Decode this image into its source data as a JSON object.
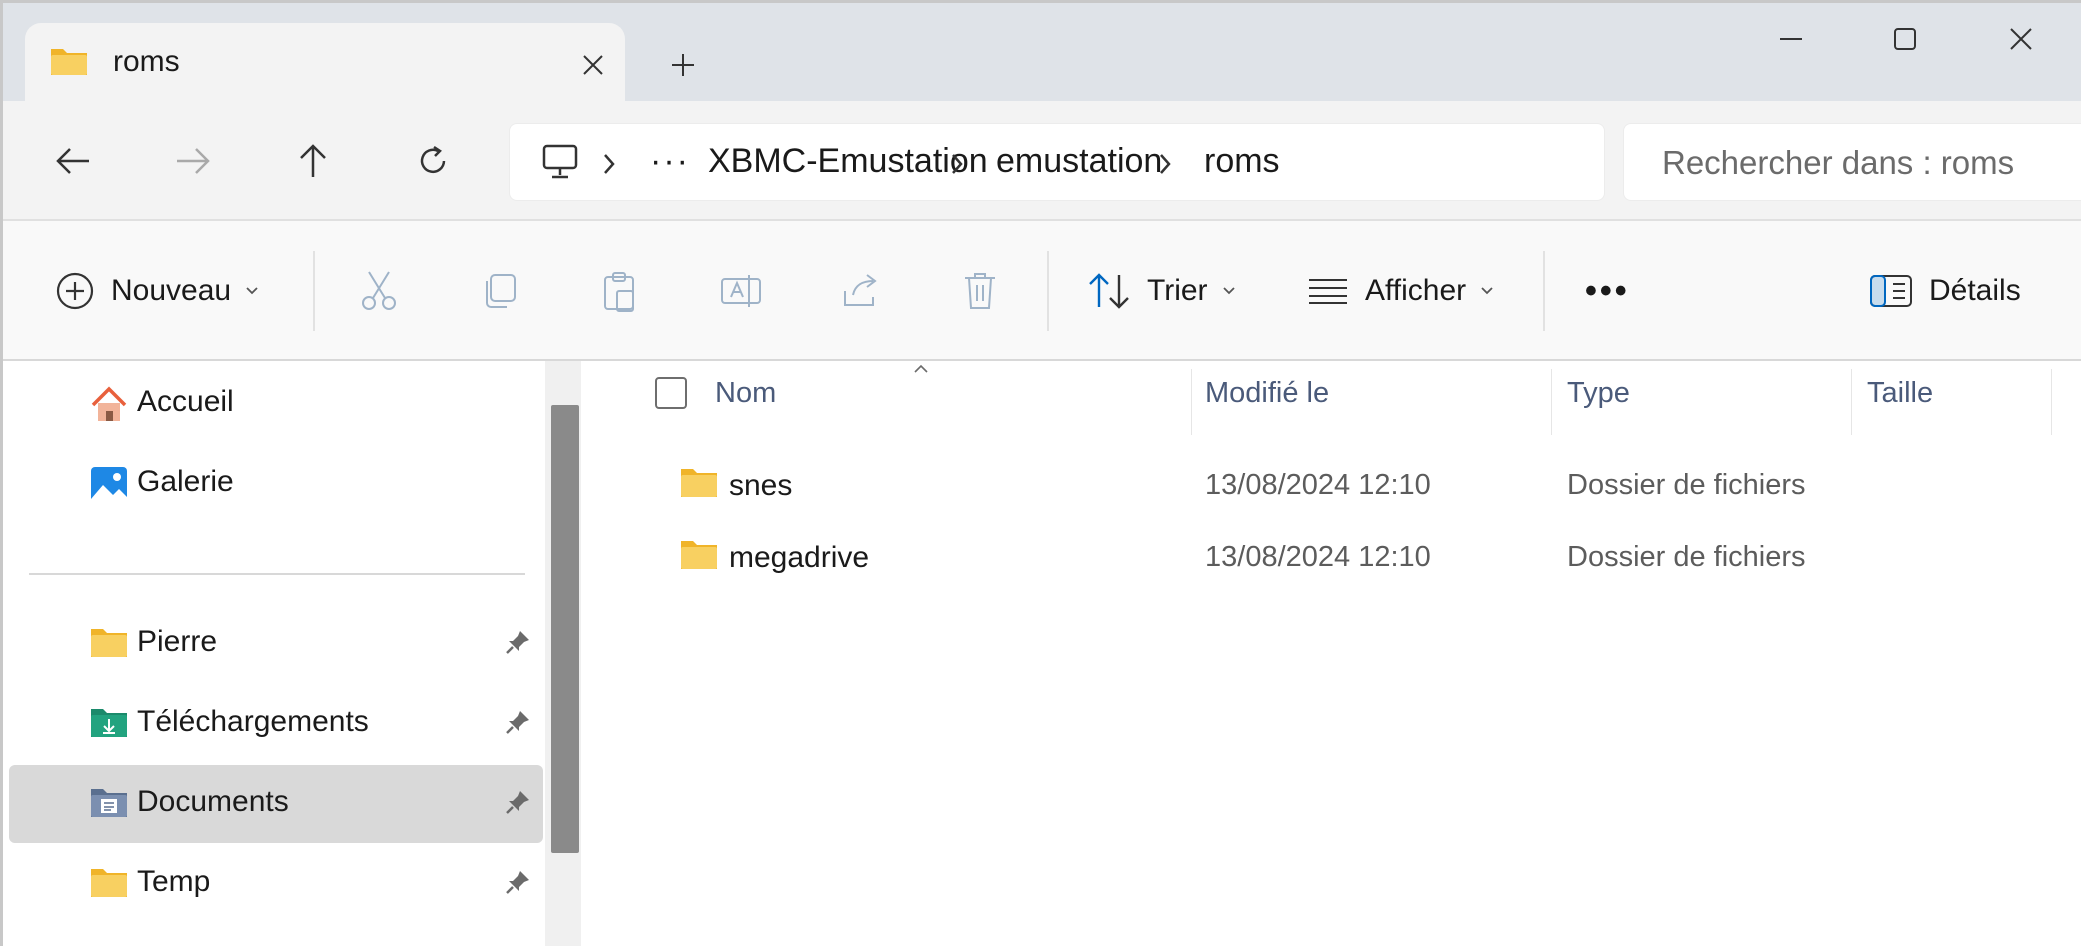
{
  "window": {
    "tab_title": "roms",
    "controls": [
      "minimize-icon",
      "maximize-icon",
      "close-icon"
    ]
  },
  "navigation": {
    "buttons": [
      "back-arrow-icon",
      "forward-arrow-icon",
      "up-arrow-icon",
      "refresh-icon"
    ],
    "breadcrumb": {
      "root_icon": "computer-icon",
      "overflow": "···",
      "items": [
        "XBMC-Emustation",
        "emustation",
        "roms"
      ]
    },
    "search_placeholder": "Rechercher dans : roms"
  },
  "commandbar": {
    "new_label": "Nouveau",
    "disabled_actions": [
      "cut-icon",
      "copy-icon",
      "paste-icon",
      "rename-icon",
      "share-icon",
      "delete-icon"
    ],
    "sort_label": "Trier",
    "view_label": "Afficher",
    "more": "•••",
    "details_label": "Détails"
  },
  "sidebar": {
    "items": [
      {
        "label": "Accueil",
        "icon": "home-icon"
      },
      {
        "label": "Galerie",
        "icon": "gallery-icon"
      },
      {
        "label": "Pierre",
        "icon": "folder-icon",
        "pinned": true
      },
      {
        "label": "Téléchargements",
        "icon": "downloads-folder-icon",
        "pinned": true
      },
      {
        "label": "Documents",
        "icon": "documents-folder-icon",
        "pinned": true,
        "selected": true
      },
      {
        "label": "Temp",
        "icon": "folder-icon",
        "pinned": true
      }
    ]
  },
  "filelist": {
    "columns": [
      "Nom",
      "Modifié le",
      "Type",
      "Taille"
    ],
    "rows": [
      {
        "name": "snes",
        "modified": "13/08/2024 12:10",
        "type": "Dossier de fichiers",
        "size": ""
      },
      {
        "name": "megadrive",
        "modified": "13/08/2024 12:10",
        "type": "Dossier de fichiers",
        "size": ""
      }
    ]
  },
  "colors": {
    "folder_yellow": "#f5c542",
    "accent_blue": "#0067c0",
    "selected_bg": "#d9d9d9",
    "disabled_icon": "#9fb3c8"
  }
}
